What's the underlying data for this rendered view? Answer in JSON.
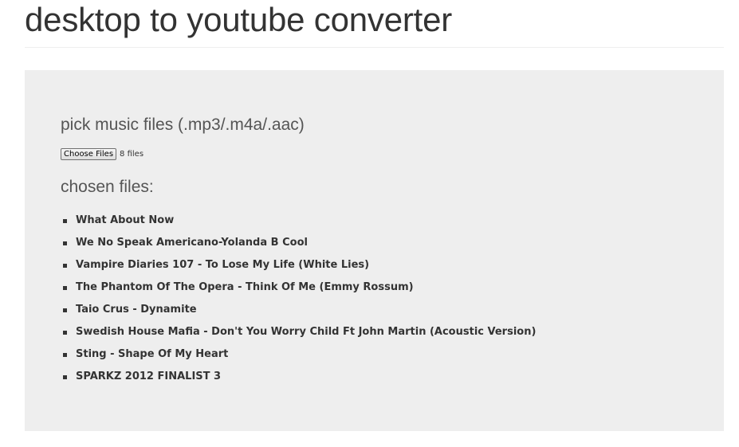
{
  "page": {
    "title": "desktop to youtube converter"
  },
  "upload": {
    "heading": "pick music files (.mp3/.m4a/.aac)",
    "choose_button_label": "Choose Files",
    "file_count": "8 files"
  },
  "chosen": {
    "heading": "chosen files:",
    "files": [
      "What About Now",
      "We No Speak Americano-Yolanda B Cool",
      "Vampire Diaries 107 - To Lose My Life (White Lies)",
      "The Phantom Of The Opera - Think Of Me (Emmy Rossum)",
      "Taio Crus - Dynamite",
      "Swedish House Mafia - Don't You Worry Child Ft John Martin (Acoustic Version)",
      "Sting - Shape Of My Heart",
      "SPARKZ 2012 FINALIST 3"
    ]
  },
  "colors": {
    "panel_background": "#eeeeee",
    "text": "#333333",
    "heading_text": "#555555"
  }
}
